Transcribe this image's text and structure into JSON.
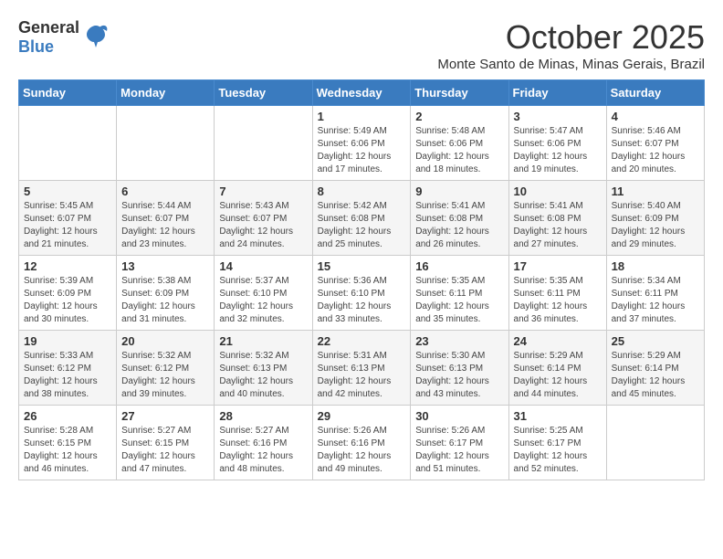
{
  "header": {
    "logo_general": "General",
    "logo_blue": "Blue",
    "month": "October 2025",
    "location": "Monte Santo de Minas, Minas Gerais, Brazil"
  },
  "days_of_week": [
    "Sunday",
    "Monday",
    "Tuesday",
    "Wednesday",
    "Thursday",
    "Friday",
    "Saturday"
  ],
  "weeks": [
    [
      {
        "day": "",
        "info": ""
      },
      {
        "day": "",
        "info": ""
      },
      {
        "day": "",
        "info": ""
      },
      {
        "day": "1",
        "info": "Sunrise: 5:49 AM\nSunset: 6:06 PM\nDaylight: 12 hours\nand 17 minutes."
      },
      {
        "day": "2",
        "info": "Sunrise: 5:48 AM\nSunset: 6:06 PM\nDaylight: 12 hours\nand 18 minutes."
      },
      {
        "day": "3",
        "info": "Sunrise: 5:47 AM\nSunset: 6:06 PM\nDaylight: 12 hours\nand 19 minutes."
      },
      {
        "day": "4",
        "info": "Sunrise: 5:46 AM\nSunset: 6:07 PM\nDaylight: 12 hours\nand 20 minutes."
      }
    ],
    [
      {
        "day": "5",
        "info": "Sunrise: 5:45 AM\nSunset: 6:07 PM\nDaylight: 12 hours\nand 21 minutes."
      },
      {
        "day": "6",
        "info": "Sunrise: 5:44 AM\nSunset: 6:07 PM\nDaylight: 12 hours\nand 23 minutes."
      },
      {
        "day": "7",
        "info": "Sunrise: 5:43 AM\nSunset: 6:07 PM\nDaylight: 12 hours\nand 24 minutes."
      },
      {
        "day": "8",
        "info": "Sunrise: 5:42 AM\nSunset: 6:08 PM\nDaylight: 12 hours\nand 25 minutes."
      },
      {
        "day": "9",
        "info": "Sunrise: 5:41 AM\nSunset: 6:08 PM\nDaylight: 12 hours\nand 26 minutes."
      },
      {
        "day": "10",
        "info": "Sunrise: 5:41 AM\nSunset: 6:08 PM\nDaylight: 12 hours\nand 27 minutes."
      },
      {
        "day": "11",
        "info": "Sunrise: 5:40 AM\nSunset: 6:09 PM\nDaylight: 12 hours\nand 29 minutes."
      }
    ],
    [
      {
        "day": "12",
        "info": "Sunrise: 5:39 AM\nSunset: 6:09 PM\nDaylight: 12 hours\nand 30 minutes."
      },
      {
        "day": "13",
        "info": "Sunrise: 5:38 AM\nSunset: 6:09 PM\nDaylight: 12 hours\nand 31 minutes."
      },
      {
        "day": "14",
        "info": "Sunrise: 5:37 AM\nSunset: 6:10 PM\nDaylight: 12 hours\nand 32 minutes."
      },
      {
        "day": "15",
        "info": "Sunrise: 5:36 AM\nSunset: 6:10 PM\nDaylight: 12 hours\nand 33 minutes."
      },
      {
        "day": "16",
        "info": "Sunrise: 5:35 AM\nSunset: 6:11 PM\nDaylight: 12 hours\nand 35 minutes."
      },
      {
        "day": "17",
        "info": "Sunrise: 5:35 AM\nSunset: 6:11 PM\nDaylight: 12 hours\nand 36 minutes."
      },
      {
        "day": "18",
        "info": "Sunrise: 5:34 AM\nSunset: 6:11 PM\nDaylight: 12 hours\nand 37 minutes."
      }
    ],
    [
      {
        "day": "19",
        "info": "Sunrise: 5:33 AM\nSunset: 6:12 PM\nDaylight: 12 hours\nand 38 minutes."
      },
      {
        "day": "20",
        "info": "Sunrise: 5:32 AM\nSunset: 6:12 PM\nDaylight: 12 hours\nand 39 minutes."
      },
      {
        "day": "21",
        "info": "Sunrise: 5:32 AM\nSunset: 6:13 PM\nDaylight: 12 hours\nand 40 minutes."
      },
      {
        "day": "22",
        "info": "Sunrise: 5:31 AM\nSunset: 6:13 PM\nDaylight: 12 hours\nand 42 minutes."
      },
      {
        "day": "23",
        "info": "Sunrise: 5:30 AM\nSunset: 6:13 PM\nDaylight: 12 hours\nand 43 minutes."
      },
      {
        "day": "24",
        "info": "Sunrise: 5:29 AM\nSunset: 6:14 PM\nDaylight: 12 hours\nand 44 minutes."
      },
      {
        "day": "25",
        "info": "Sunrise: 5:29 AM\nSunset: 6:14 PM\nDaylight: 12 hours\nand 45 minutes."
      }
    ],
    [
      {
        "day": "26",
        "info": "Sunrise: 5:28 AM\nSunset: 6:15 PM\nDaylight: 12 hours\nand 46 minutes."
      },
      {
        "day": "27",
        "info": "Sunrise: 5:27 AM\nSunset: 6:15 PM\nDaylight: 12 hours\nand 47 minutes."
      },
      {
        "day": "28",
        "info": "Sunrise: 5:27 AM\nSunset: 6:16 PM\nDaylight: 12 hours\nand 48 minutes."
      },
      {
        "day": "29",
        "info": "Sunrise: 5:26 AM\nSunset: 6:16 PM\nDaylight: 12 hours\nand 49 minutes."
      },
      {
        "day": "30",
        "info": "Sunrise: 5:26 AM\nSunset: 6:17 PM\nDaylight: 12 hours\nand 51 minutes."
      },
      {
        "day": "31",
        "info": "Sunrise: 5:25 AM\nSunset: 6:17 PM\nDaylight: 12 hours\nand 52 minutes."
      },
      {
        "day": "",
        "info": ""
      }
    ]
  ]
}
